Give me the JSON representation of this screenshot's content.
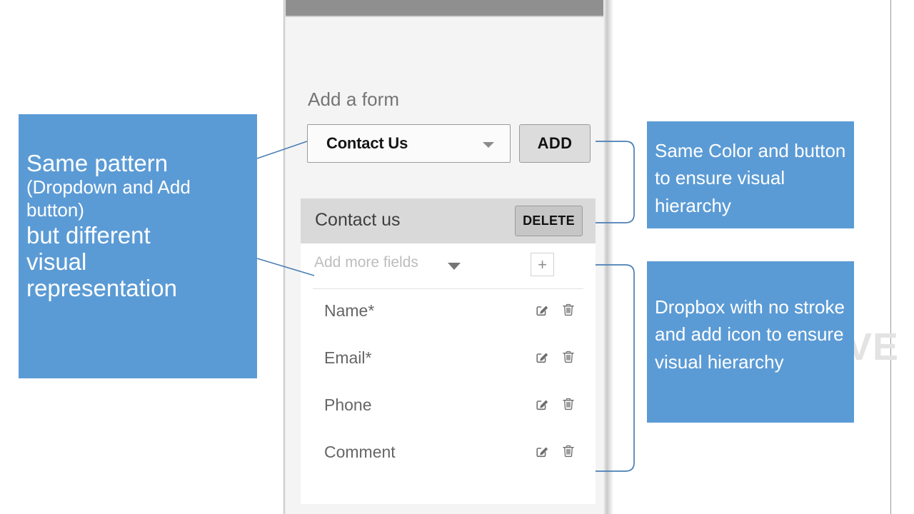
{
  "slide": {
    "watermark_text": "VE"
  },
  "app": {
    "titlebar": "",
    "add_form_section": {
      "heading": "Add a form",
      "select_value": "Contact Us",
      "select_caret_icon": "chevron-down-icon",
      "add_button_label": "ADD"
    },
    "form_card": {
      "title": "Contact us",
      "delete_button_label": "DELETE",
      "add_more": {
        "label": "Add more fields",
        "caret_icon": "chevron-down-icon",
        "add_button_label": "+"
      },
      "fields": [
        {
          "label": "Name*",
          "edit_icon": "edit-pencil-icon",
          "delete_icon": "trash-icon"
        },
        {
          "label": "Email*",
          "edit_icon": "edit-pencil-icon",
          "delete_icon": "trash-icon"
        },
        {
          "label": "Phone",
          "edit_icon": "edit-pencil-icon",
          "delete_icon": "trash-icon"
        },
        {
          "label": "Comment",
          "edit_icon": "edit-pencil-icon",
          "delete_icon": "trash-icon"
        }
      ]
    }
  },
  "annotations": {
    "left": {
      "line1": "Same pattern",
      "line2": "(Dropdown and Add",
      "line3": "button)",
      "line4": "but different",
      "line5": "visual",
      "line6": "representation"
    },
    "right_top": {
      "text": "Same Color and button to ensure visual hierarchy"
    },
    "right_bottom": {
      "text": "Dropbox with no stroke and add icon to ensure visual hierarchy"
    }
  },
  "colors": {
    "callout_blue": "#5B9BD5",
    "connector_blue": "#4a7eb5",
    "panel_bg": "#f4f4f4",
    "titlebar_gray": "#8f8f8f",
    "card_header_gray": "#d9d9d9",
    "button_gray": "#dcdcdc",
    "delete_button_gray": "#c6c6c6"
  }
}
